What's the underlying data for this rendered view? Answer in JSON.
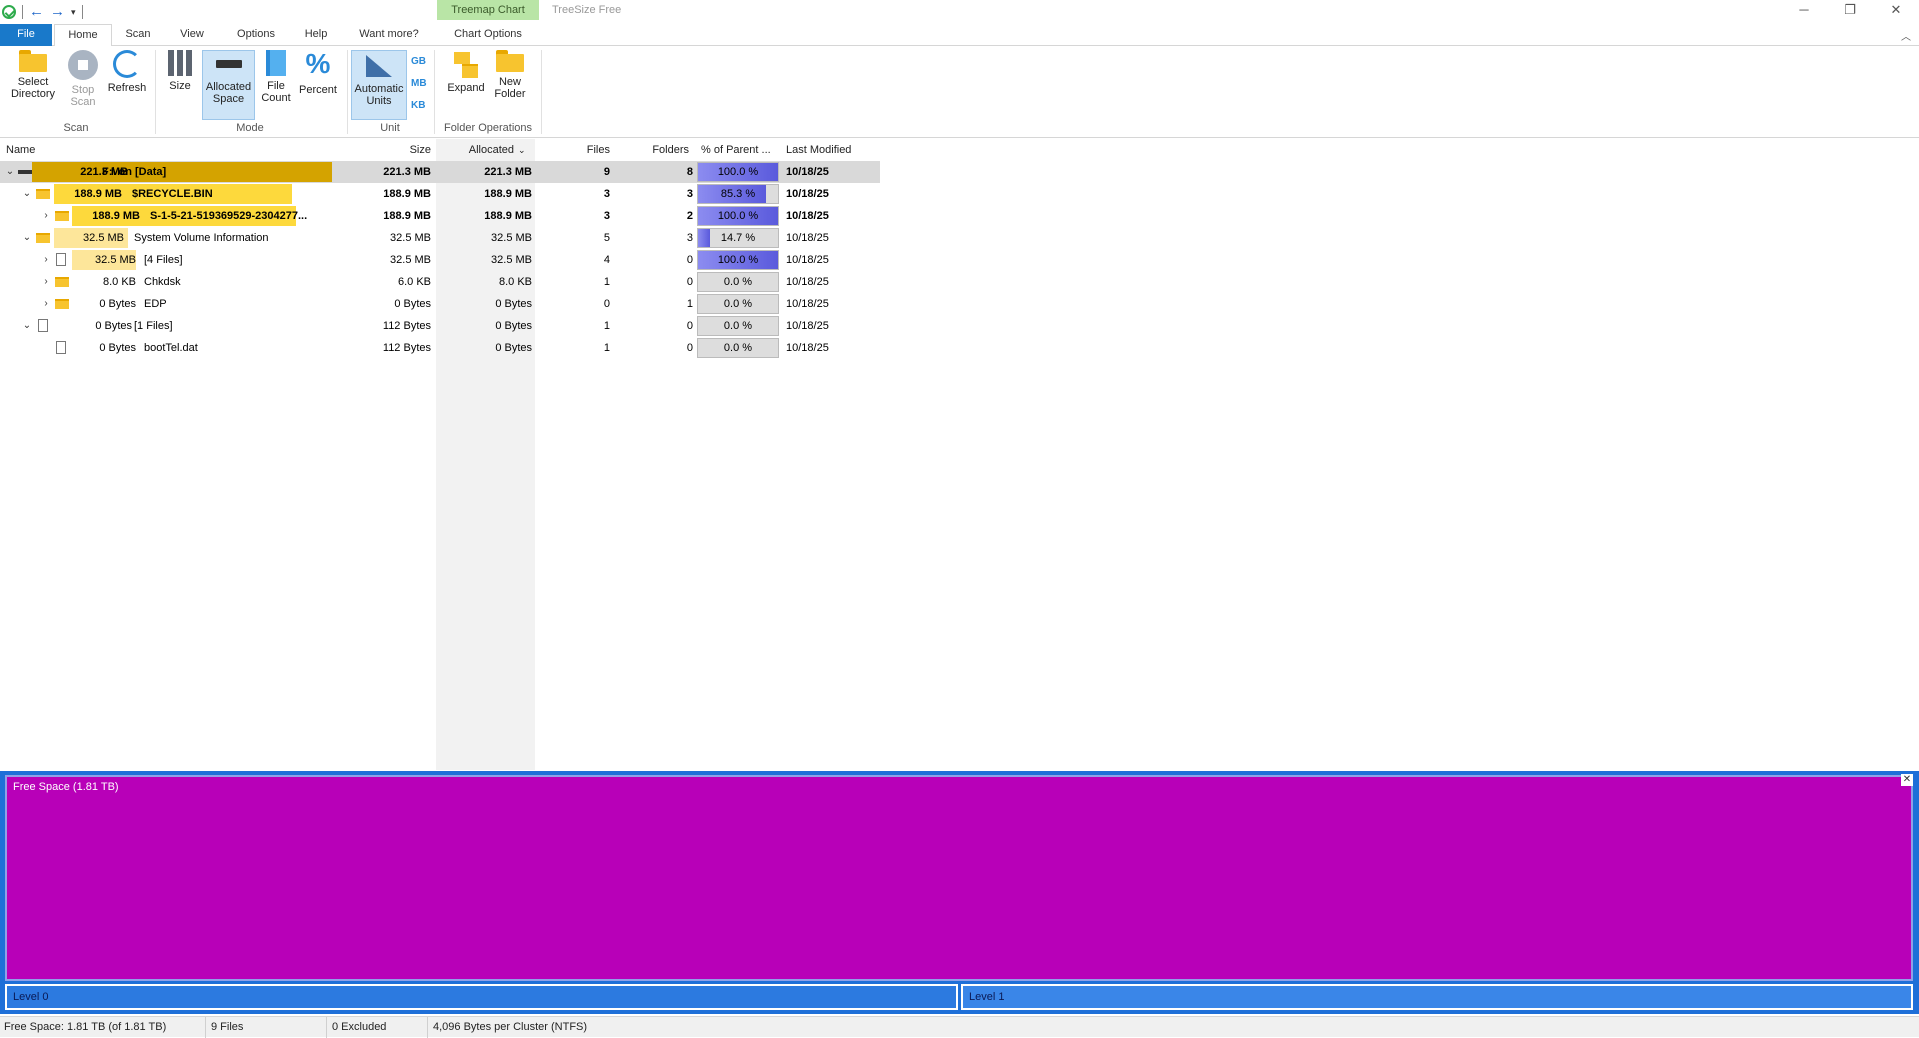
{
  "window": {
    "title": "TreeSize Free",
    "context_tab": "Treemap Chart",
    "minimize": "─",
    "restore": "❐",
    "close": "✕"
  },
  "tabs": [
    "File",
    "Home",
    "Scan",
    "View",
    "Options",
    "Help",
    "Want more?",
    "Chart Options"
  ],
  "ribbon": {
    "select_directory": "Select Directory",
    "stop_scan": "Stop Scan",
    "refresh": "Refresh",
    "scan_group": "Scan",
    "size": "Size",
    "allocated_space": "Allocated Space",
    "file_count": "File Count",
    "percent": "Percent",
    "mode_group": "Mode",
    "automatic_units": "Automatic Units",
    "unit_gb": "GB",
    "unit_mb": "MB",
    "unit_kb": "KB",
    "unit_group": "Unit",
    "expand": "Expand",
    "new_folder": "New Folder",
    "folder_ops_group": "Folder Operations"
  },
  "columns": {
    "name": "Name",
    "size": "Size",
    "allocated": "Allocated",
    "files": "Files",
    "folders": "Folders",
    "percent": "% of Parent ...",
    "modified": "Last Modified"
  },
  "rows": [
    {
      "chev": "⌄",
      "size_label": "221.3 MB",
      "name": "F:\\  on  [Data]",
      "size": "221.3 MB",
      "allocated": "221.3 MB",
      "files": "9",
      "folders": "8",
      "percent": "100.0 %",
      "pct": 100,
      "modified": "10/18/25"
    },
    {
      "chev": "⌄",
      "size_label": "188.9 MB",
      "name": "$RECYCLE.BIN",
      "size": "188.9 MB",
      "allocated": "188.9 MB",
      "files": "3",
      "folders": "3",
      "percent": "85.3 %",
      "pct": 85.3,
      "modified": "10/18/25"
    },
    {
      "chev": "›",
      "size_label": "188.9 MB",
      "name": "S-1-5-21-519369529-2304277...",
      "size": "188.9 MB",
      "allocated": "188.9 MB",
      "files": "3",
      "folders": "2",
      "percent": "100.0 %",
      "pct": 100,
      "modified": "10/18/25"
    },
    {
      "chev": "⌄",
      "size_label": "32.5 MB",
      "name": "System Volume Information",
      "size": "32.5 MB",
      "allocated": "32.5 MB",
      "files": "5",
      "folders": "3",
      "percent": "14.7 %",
      "pct": 14.7,
      "modified": "10/18/25"
    },
    {
      "chev": "›",
      "size_label": "32.5 MB",
      "name": "[4 Files]",
      "size": "32.5 MB",
      "allocated": "32.5 MB",
      "files": "4",
      "folders": "0",
      "percent": "100.0 %",
      "pct": 100,
      "modified": "10/18/25"
    },
    {
      "chev": "›",
      "size_label": "8.0 KB",
      "name": "Chkdsk",
      "size": "6.0 KB",
      "allocated": "8.0 KB",
      "files": "1",
      "folders": "0",
      "percent": "0.0 %",
      "pct": 0,
      "modified": "10/18/25"
    },
    {
      "chev": "›",
      "size_label": "0 Bytes",
      "name": "EDP",
      "size": "0 Bytes",
      "allocated": "0 Bytes",
      "files": "0",
      "folders": "1",
      "percent": "0.0 %",
      "pct": 0,
      "modified": "10/18/25"
    },
    {
      "chev": "⌄",
      "size_label": "0 Bytes",
      "name": "[1 Files]",
      "size": "112 Bytes",
      "allocated": "0 Bytes",
      "files": "1",
      "folders": "0",
      "percent": "0.0 %",
      "pct": 0,
      "modified": "10/18/25"
    },
    {
      "chev": "",
      "size_label": "0 Bytes",
      "name": "bootTel.dat",
      "size": "112 Bytes",
      "allocated": "0 Bytes",
      "files": "1",
      "folders": "0",
      "percent": "0.0 %",
      "pct": 0,
      "modified": "10/18/25"
    }
  ],
  "treemap": {
    "free_space": "Free Space (1.81 TB)",
    "close": "✕",
    "level0": "Level 0",
    "level1": "Level 1"
  },
  "status": {
    "free_space": "Free Space: 1.81 TB  (of 1.81 TB)",
    "files": "9 Files",
    "excluded": "0 Excluded",
    "cluster": "4,096 Bytes per Cluster (NTFS)"
  },
  "colors": {
    "accent": "#1979ca",
    "treemap_free": "#b800b8",
    "name_bar": "#fde69a",
    "name_bar_root": "#d4a300"
  }
}
